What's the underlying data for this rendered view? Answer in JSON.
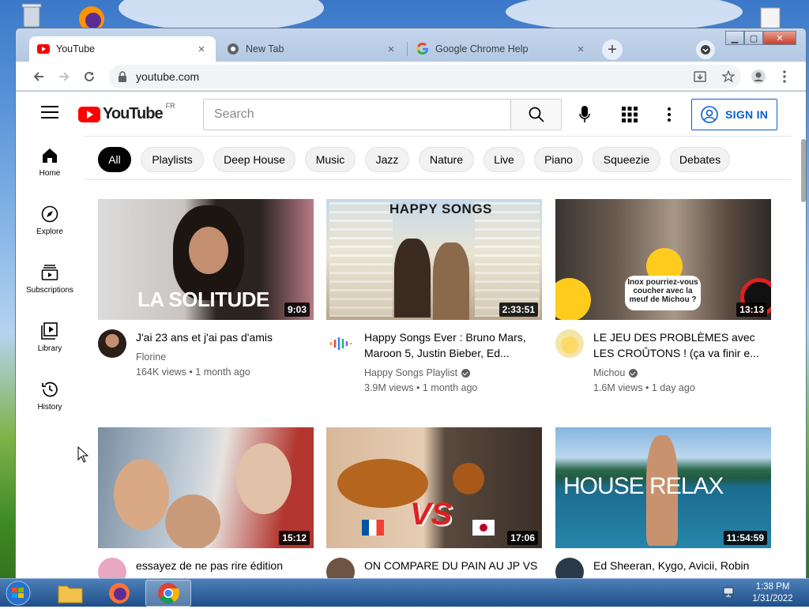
{
  "browser": {
    "tabs": [
      {
        "title": "YouTube",
        "icon": "youtube-favicon",
        "active": true
      },
      {
        "title": "New Tab",
        "icon": "chrome-favicon",
        "active": false
      },
      {
        "title": "Google Chrome Help",
        "icon": "google-favicon",
        "active": false
      }
    ],
    "url": "youtube.com"
  },
  "youtube": {
    "logo_text": "YouTube",
    "region": "FR",
    "search_placeholder": "Search",
    "sign_in": "SIGN IN",
    "sidebar": [
      {
        "label": "Home",
        "icon": "home-icon"
      },
      {
        "label": "Explore",
        "icon": "compass-icon"
      },
      {
        "label": "Subscriptions",
        "icon": "subscriptions-icon"
      },
      {
        "label": "Library",
        "icon": "library-icon"
      },
      {
        "label": "History",
        "icon": "history-icon"
      }
    ],
    "chips": [
      "All",
      "Playlists",
      "Deep House",
      "Music",
      "Jazz",
      "Nature",
      "Live",
      "Piano",
      "Squeezie",
      "Debates"
    ],
    "videos": [
      {
        "title": "J'ai 23 ans et j'ai pas d'amis",
        "channel": "Florine",
        "verified": false,
        "views": "164K views",
        "age": "1 month ago",
        "duration": "9:03",
        "thumb_text": "LA SOLITUDE"
      },
      {
        "title": "Happy Songs Ever : Bruno Mars, Maroon 5, Justin Bieber, Ed...",
        "channel": "Happy Songs Playlist",
        "verified": true,
        "views": "3.9M views",
        "age": "1 month ago",
        "duration": "2:33:51",
        "thumb_text": "HAPPY SONGS"
      },
      {
        "title": "LE JEU DES PROBLÈMES avec LES CROÛTONS ! (ça va finir e...",
        "channel": "Michou",
        "verified": true,
        "views": "1.6M views",
        "age": "1 day ago",
        "duration": "13:13",
        "thumb_text": "Inox pourriez-vous coucher avec la meuf de Michou ?"
      },
      {
        "title": "essayez de ne pas rire édition",
        "channel": "",
        "verified": false,
        "views": "",
        "age": "",
        "duration": "15:12",
        "thumb_text": ""
      },
      {
        "title": "ON COMPARE DU PAIN AU JP VS",
        "channel": "",
        "verified": false,
        "views": "",
        "age": "",
        "duration": "17:06",
        "thumb_text": "VS"
      },
      {
        "title": "Ed Sheeran, Kygo, Avicii, Robin",
        "channel": "",
        "verified": false,
        "views": "",
        "age": "",
        "duration": "11:54:59",
        "thumb_text": "HOUSE RELAX"
      }
    ]
  },
  "taskbar": {
    "time": "1:38 PM",
    "date": "1/31/2022"
  },
  "colors": {
    "youtube_red": "#ff0000",
    "signin_blue": "#065fd4",
    "chip_selected": "#030303"
  }
}
